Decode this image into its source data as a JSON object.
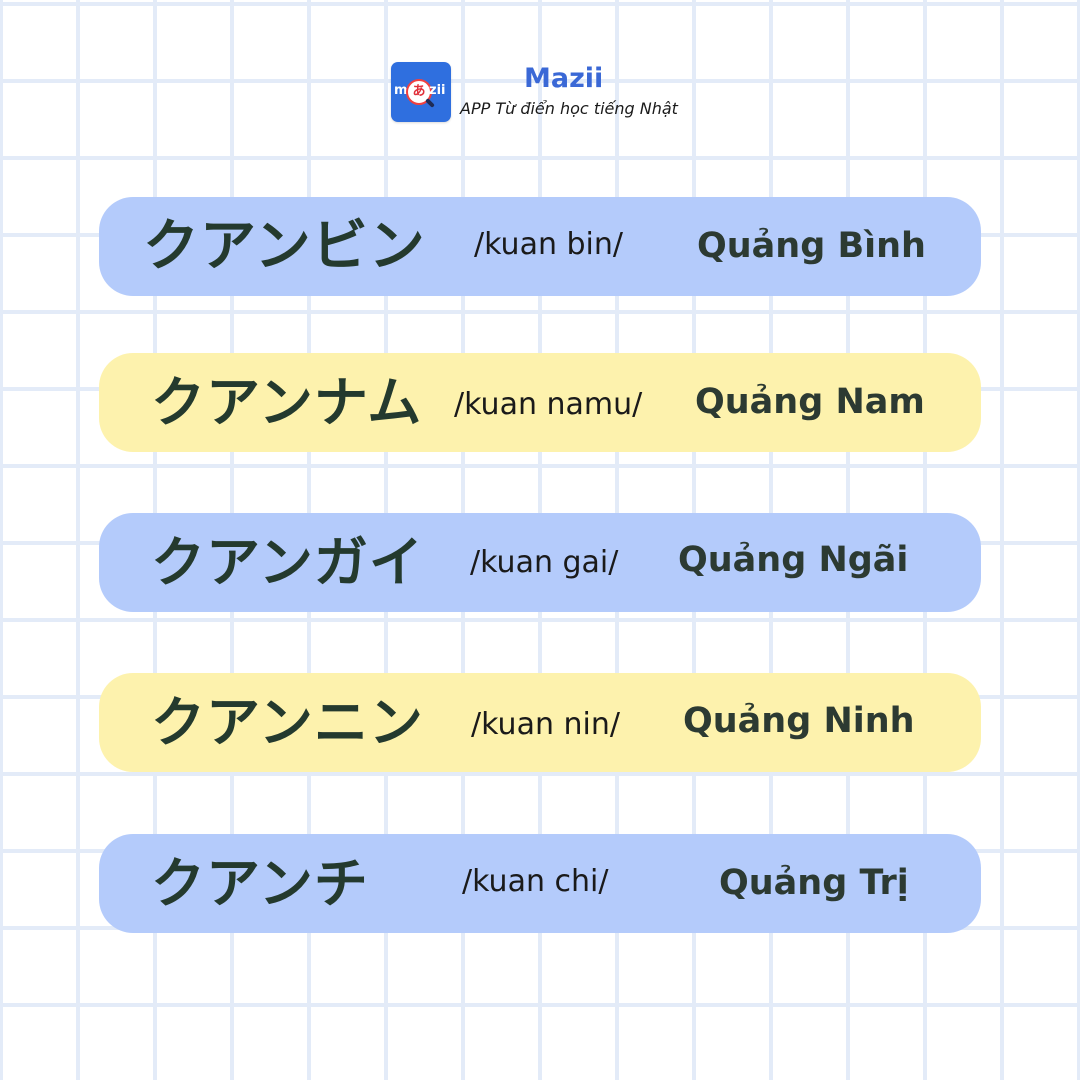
{
  "brand": {
    "name": "Mazii",
    "tagline": "APP Từ điển học tiếng Nhật",
    "logo": {
      "icon": "mazii-logo-icon",
      "text_left": "m",
      "text_center": "あ",
      "text_right": "zii",
      "color": "#2f6fdf"
    }
  },
  "colors": {
    "row_blue": "#b4cbfb",
    "row_yellow": "#fdf2ad",
    "text_dark_green": "#243a2e",
    "brand_blue": "#3a68d6",
    "grid": "#e3ebf8"
  },
  "rows": [
    {
      "katakana": "クアンビン",
      "romaji": "/kuan bin/",
      "province": "Quảng Bình",
      "color": "blue"
    },
    {
      "katakana": "クアンナム",
      "romaji": "/kuan namu/",
      "province": "Quảng Nam",
      "color": "yellow"
    },
    {
      "katakana": "クアンガイ",
      "romaji": "/kuan gai/",
      "province": "Quảng Ngãi",
      "color": "blue"
    },
    {
      "katakana": "クアンニン",
      "romaji": "/kuan nin/",
      "province": "Quảng Ninh",
      "color": "yellow"
    },
    {
      "katakana": "クアンチ",
      "romaji": "/kuan chi/",
      "province": "Quảng Trị",
      "color": "blue"
    }
  ]
}
